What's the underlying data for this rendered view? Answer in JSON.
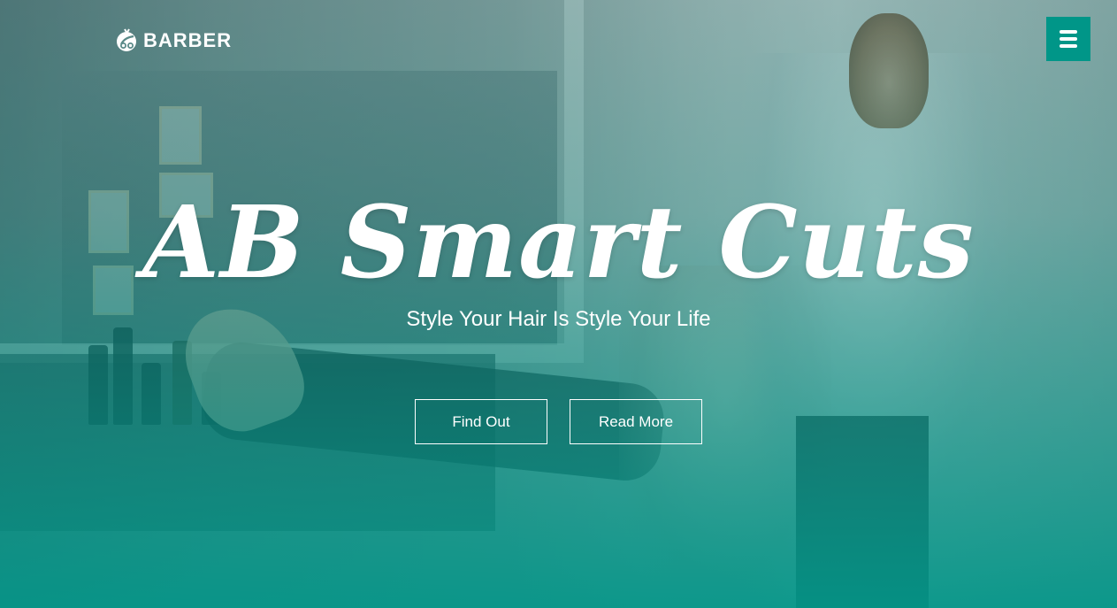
{
  "header": {
    "logo_icon": "barber-scissors-icon",
    "logo_text": "BARBER",
    "menu_icon": "hamburger-menu-icon"
  },
  "hero": {
    "title": "AB Smart Cuts",
    "subtitle": "Style Your Hair Is Style Your Life",
    "buttons": [
      {
        "label": "Find Out"
      },
      {
        "label": "Read More"
      }
    ]
  },
  "colors": {
    "accent": "#009688",
    "text": "#ffffff"
  }
}
